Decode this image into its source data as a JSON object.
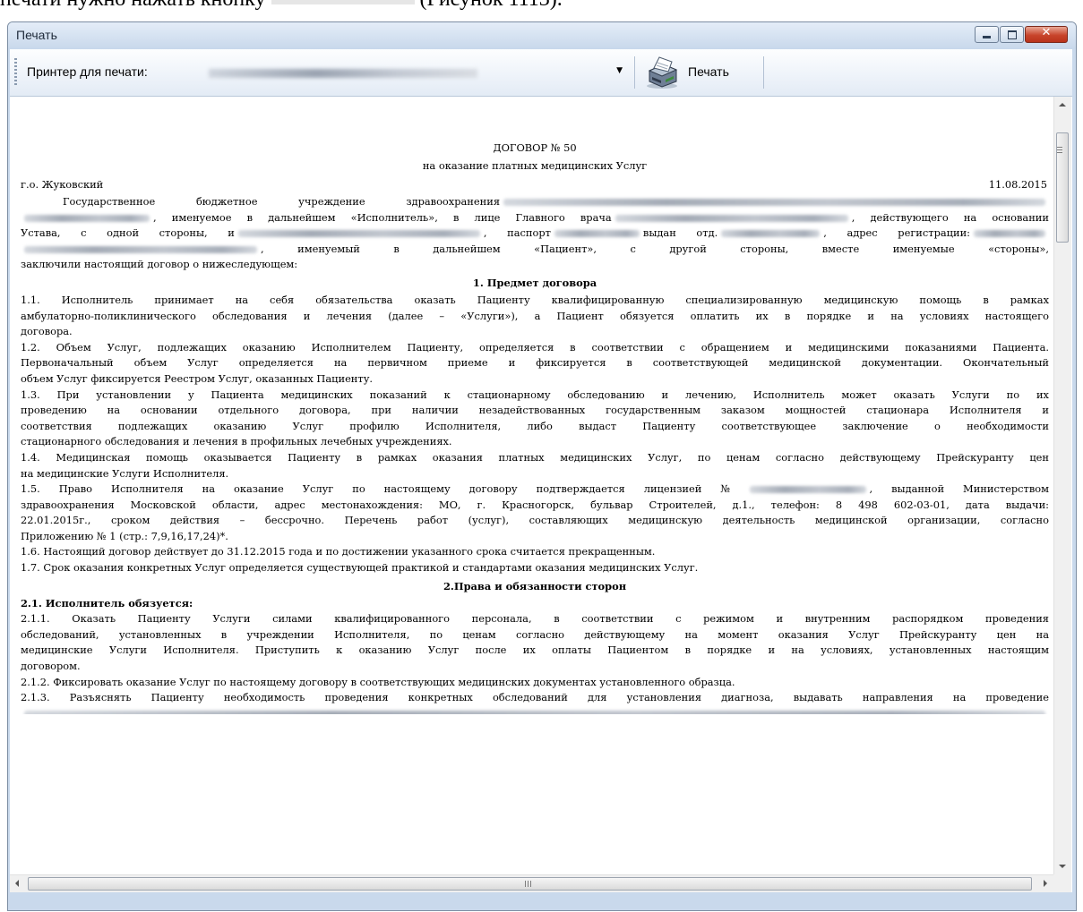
{
  "caption": {
    "before": "печати нужно нажать кнопку",
    "after": "(Рисунок 1113)."
  },
  "window": {
    "title": "Печать"
  },
  "toolbar": {
    "printer_label": "Принтер для печати:",
    "print_label": "Печать"
  },
  "icons": {
    "minimize": "minimize-icon",
    "maximize": "maximize-icon",
    "close": "close-icon",
    "printer": "printer-icon",
    "dropdown": "chevron-down-icon"
  },
  "doc": {
    "title": "ДОГОВОР № 50",
    "subtitle": "на оказание платных медицинских Услуг",
    "city": "г.о. Жуковский",
    "date": "11.08.2015",
    "intro": [
      "Государственное бюджетное учреждение здравоохранения",
      ", именуемое в дальнейшем «Исполнитель», в лице Главного врача",
      ", действующего на основании",
      "Устава, с одной стороны, и",
      ", паспорт",
      "выдан отд.",
      ", адрес регистрации:",
      ", именуемый в дальнейшем «Пациент», с другой стороны, вместе именуемые «стороны»,",
      "заключили настоящий договор о нижеследующем:"
    ],
    "section1": "1. Предмет договора",
    "p1_1": [
      "1.1. Исполнитель принимает на себя обязательства оказать Пациенту квалифицированную специализированную медицинскую помощь в рамках",
      "амбулаторно-поликлинического обследования и лечения (далее – «Услуги»), а Пациент обязуется оплатить их в порядке и на условиях настоящего",
      "договора."
    ],
    "p1_2": [
      "1.2. Объем Услуг, подлежащих оказанию Исполнителем Пациенту, определяется в соответствии с обращением и медицинскими показаниями Пациента.",
      "Первоначальный объем Услуг определяется на первичном приеме и фиксируется в соответствующей медицинской документации. Окончательный",
      "объем Услуг фиксируется Реестром Услуг, оказанных Пациенту."
    ],
    "p1_3": [
      "1.3. При установлении у Пациента медицинских показаний к стационарному обследованию и лечению, Исполнитель может оказать Услуги по их",
      "проведению на основании отдельного договора, при наличии незадействованных государственным заказом мощностей стационара Исполнителя и",
      "соответствия подлежащих оказанию Услуг профилю Исполнителя, либо выдаст Пациенту соответствующее заключение о необходимости",
      "стационарного обследования и лечения в профильных лечебных учреждениях."
    ],
    "p1_4": [
      "1.4. Медицинская помощь оказывается Пациенту в рамках оказания платных медицинских Услуг, по ценам согласно действующему Прейскуранту цен",
      "на медицинские Услуги Исполнителя."
    ],
    "p1_5": [
      "1.5. Право Исполнителя на оказание Услуг по настоящему договору подтверждается лицензией №",
      ", выданной Министерством",
      "здравоохранения Московской области, адрес местонахождения: МО, г. Красногорск, бульвар Строителей, д.1., телефон: 8 498 602-03-01, дата выдачи:",
      "22.01.2015г., сроком действия – бессрочно. Перечень работ (услуг), составляющих медицинскую деятельность медицинской организации, согласно",
      "Приложению № 1 (стр.: 7,9,16,17,24)*."
    ],
    "p1_6": "1.6. Настоящий договор действует до 31.12.2015 года и по достижении указанного срока считается прекращенным.",
    "p1_7": "1.7. Срок оказания конкретных Услуг определяется существующей практикой и стандартами оказания медицинских Услуг.",
    "section2": "2.Права и обязанности сторон",
    "sub2_1": "2.1. Исполнитель обязуется:",
    "p2_1_1": [
      "2.1.1. Оказать Пациенту Услуги силами квалифицированного персонала, в соответствии с режимом и внутренним распорядком проведения",
      "обследований, установленных в учреждении Исполнителя, по ценам согласно действующему на момент оказания Услуг Прейскуранту цен на",
      "медицинские Услуги Исполнителя. Приступить к оказанию Услуг после их оплаты Пациентом в порядке и на условиях, установленных настоящим",
      "договором."
    ],
    "p2_1_2": "2.1.2. Фиксировать оказание Услуг по настоящему договору в соответствующих медицинских документах установленного образца.",
    "p2_1_3": "2.1.3. Разъяснять Пациенту необходимость проведения конкретных обследований для установления диагноза, выдавать направления на проведение"
  }
}
